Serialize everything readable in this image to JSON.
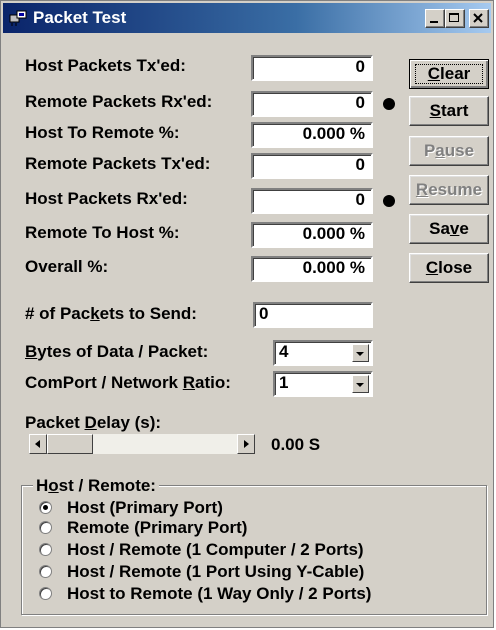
{
  "window": {
    "title": "Packet Test"
  },
  "stats": [
    {
      "label": "Host Packets Tx'ed:",
      "value": "0"
    },
    {
      "label": "Remote Packets Rx'ed:",
      "value": "0"
    },
    {
      "label": "Host To Remote %:",
      "value": "0.000 %"
    },
    {
      "label": "Remote Packets Tx'ed:",
      "value": "0"
    },
    {
      "label": "Host Packets Rx'ed:",
      "value": "0"
    },
    {
      "label": "Remote To Host %:",
      "value": "0.000 %"
    },
    {
      "label": "Overall %:",
      "value": "0.000 %"
    }
  ],
  "buttons": {
    "clear": {
      "pre": "",
      "u": "C",
      "post": "lear",
      "enabled": true
    },
    "start": {
      "pre": "",
      "u": "S",
      "post": "tart",
      "enabled": true
    },
    "pause": {
      "pre": "P",
      "u": "a",
      "post": "use",
      "enabled": false
    },
    "resume": {
      "pre": "",
      "u": "R",
      "post": "esume",
      "enabled": false
    },
    "save": {
      "pre": "Sa",
      "u": "v",
      "post": "e",
      "enabled": true
    },
    "close": {
      "pre": "",
      "u": "C",
      "post": "lose",
      "enabled": true
    }
  },
  "settings": {
    "packets_to_send": {
      "pre": "# of Pac",
      "u": "k",
      "post": "ets to Send:",
      "value": "0"
    },
    "bytes_per_packet": {
      "pre": "",
      "u": "B",
      "post": "ytes of Data / Packet:",
      "value": "4"
    },
    "comport_ratio": {
      "pre": "ComPort / Network ",
      "u": "R",
      "post": "atio:",
      "value": "1"
    }
  },
  "packet_delay": {
    "pre": "Packet ",
    "u": "D",
    "post": "elay (s):",
    "value": "0.00 S",
    "slider_fraction": 0
  },
  "mode": {
    "title_pre": "H",
    "title_u": "o",
    "title_post": "st / Remote:",
    "options": [
      {
        "label": "Host (Primary Port)",
        "selected": true
      },
      {
        "label": "Remote (Primary Port)",
        "selected": false
      },
      {
        "label": "Host / Remote (1 Computer / 2 Ports)",
        "selected": false
      },
      {
        "label": "Host / Remote (1 Port Using Y-Cable)",
        "selected": false
      },
      {
        "label": "Host to Remote (1 Way Only / 2 Ports)",
        "selected": false
      }
    ]
  }
}
